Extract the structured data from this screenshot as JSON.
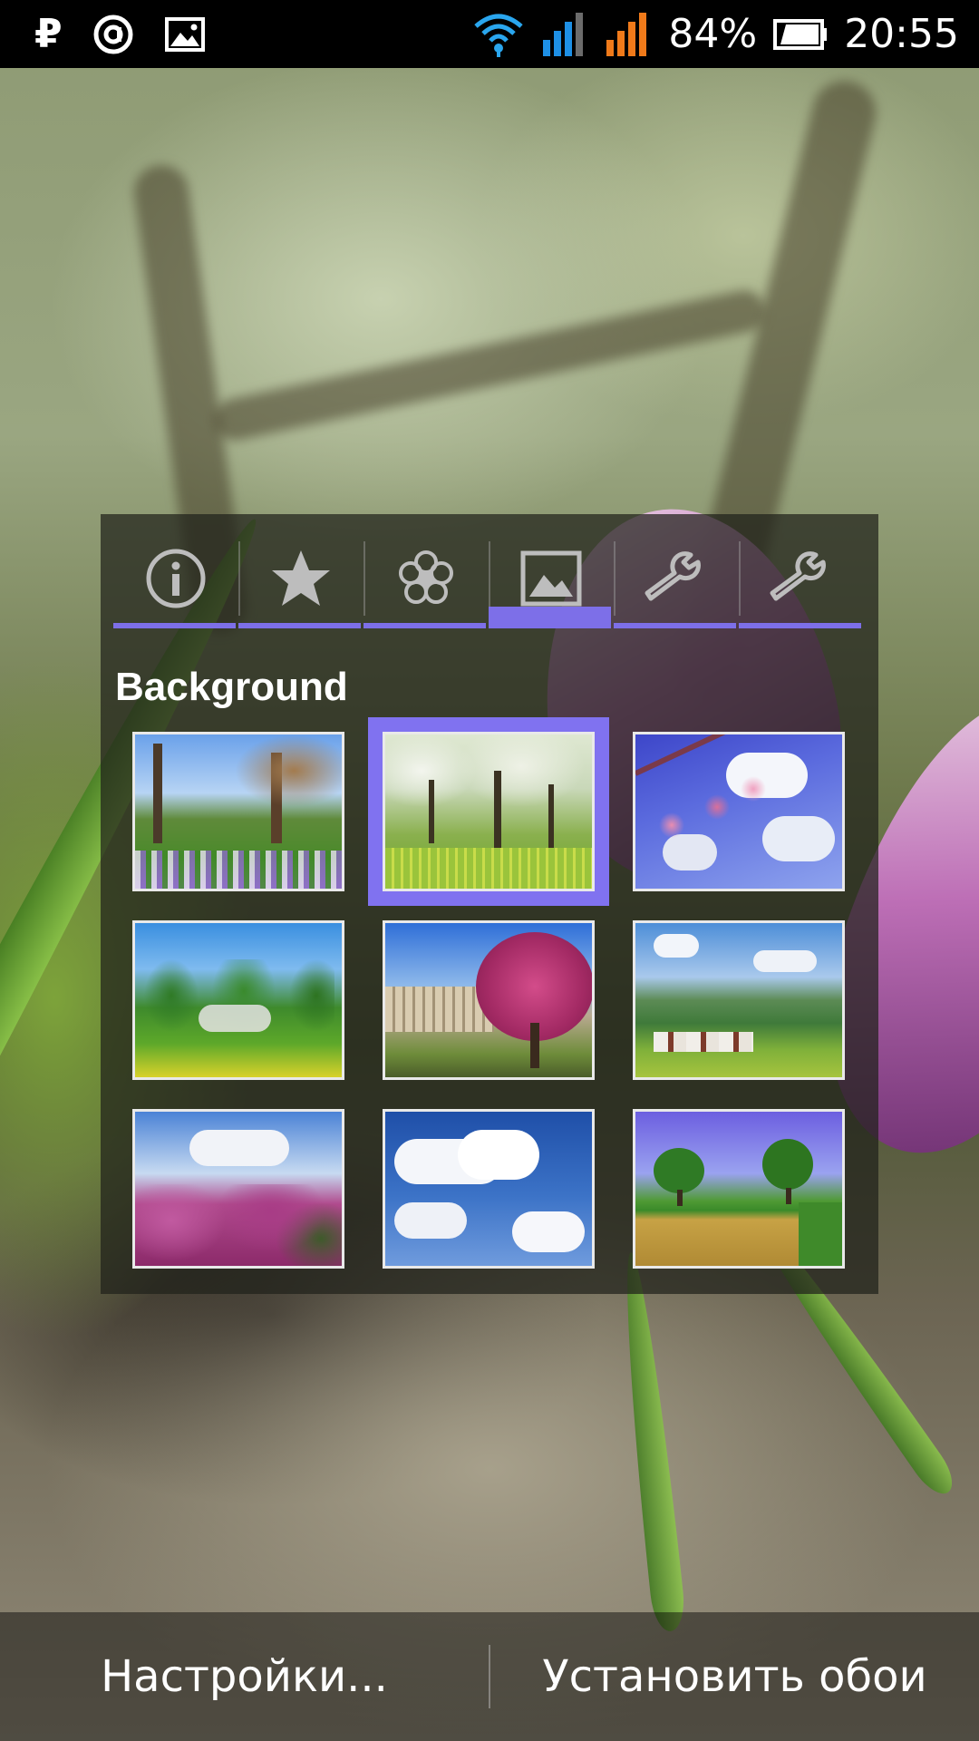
{
  "status_bar": {
    "battery_percent": "84%",
    "time": "20:55",
    "icons": [
      "ruble-icon",
      "app-notification-icon",
      "image-notification-icon",
      "wifi-icon",
      "signal-sim1-icon",
      "signal-sim2-icon",
      "battery-icon"
    ],
    "signal_colors": {
      "sim1": "#1e90e6",
      "sim2": "#f07a1a"
    }
  },
  "panel": {
    "tabs": [
      {
        "icon": "info-icon",
        "active": false
      },
      {
        "icon": "star-icon",
        "active": false
      },
      {
        "icon": "flower-icon",
        "active": false
      },
      {
        "icon": "image-icon",
        "active": true
      },
      {
        "icon": "wrench-icon",
        "active": false
      },
      {
        "icon": "wrench-icon",
        "active": false
      }
    ],
    "accent_color": "#7d6fe8",
    "section_title": "Background",
    "selected_index": 1,
    "thumbnails": [
      "park-crocus-thumbnail",
      "blossom-orchard-thumbnail",
      "blossom-branch-sky-thumbnail",
      "spring-trees-dandelions-thumbnail",
      "pink-tree-building-thumbnail",
      "valley-farm-thumbnail",
      "pink-blossom-trees-thumbnail",
      "clouds-sky-thumbnail",
      "two-trees-field-thumbnail"
    ]
  },
  "bottom_bar": {
    "settings_label": "Настройки...",
    "set_wallpaper_label": "Установить обои"
  }
}
